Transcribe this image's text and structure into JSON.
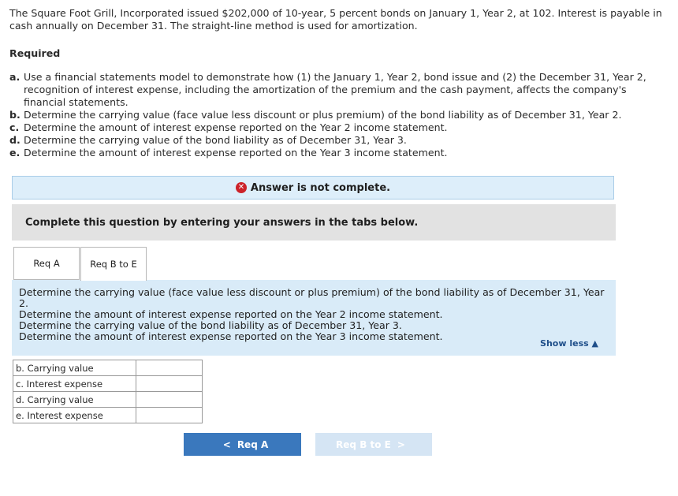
{
  "problem": {
    "text": "The Square Foot Grill, Incorporated issued $202,000 of 10-year, 5 percent bonds on January 1, Year 2, at 102. Interest is payable in cash annually on December 31. The straight-line method is used for amortization."
  },
  "required": {
    "heading": "Required",
    "items": [
      {
        "letter": "a.",
        "text": "Use a financial statements model to demonstrate how (1) the January 1, Year 2, bond issue and (2) the December 31, Year 2, recognition of interest expense, including the amortization of the premium and the cash payment, affects the company's financial statements."
      },
      {
        "letter": "b.",
        "text": "Determine the carrying value (face value less discount or plus premium) of the bond liability as of December 31, Year 2."
      },
      {
        "letter": "c.",
        "text": "Determine the amount of interest expense reported on the Year 2 income statement."
      },
      {
        "letter": "d.",
        "text": "Determine the carrying value of the bond liability as of December 31, Year 3."
      },
      {
        "letter": "e.",
        "text": "Determine the amount of interest expense reported on the Year 3 income statement."
      }
    ]
  },
  "notice": {
    "icon": "x-circle-icon",
    "text": "Answer is not complete."
  },
  "complete_text": "Complete this question by entering your answers in the tabs below.",
  "tabs": [
    {
      "label": "Req A"
    },
    {
      "label": "Req B to E"
    }
  ],
  "panel": {
    "lines": [
      "Determine the carrying value (face value less discount or plus premium) of the bond liability as of December 31, Year 2.",
      "Determine the amount of interest expense reported on the Year 2 income statement.",
      "Determine the carrying value of the bond liability as of December 31, Year 3.",
      "Determine the amount of interest expense reported on the Year 3 income statement."
    ],
    "show_less": "Show less"
  },
  "answers": [
    {
      "label": "b. Carrying value",
      "value": ""
    },
    {
      "label": "c. Interest expense",
      "value": ""
    },
    {
      "label": "d. Carrying value",
      "value": ""
    },
    {
      "label": "e. Interest expense",
      "value": ""
    }
  ],
  "nav": {
    "prev_label": "Req A",
    "next_label": "Req B to E"
  },
  "colors": {
    "accent": "#3a78bd",
    "error": "#cc2229",
    "panel": "#d9ebf8"
  }
}
